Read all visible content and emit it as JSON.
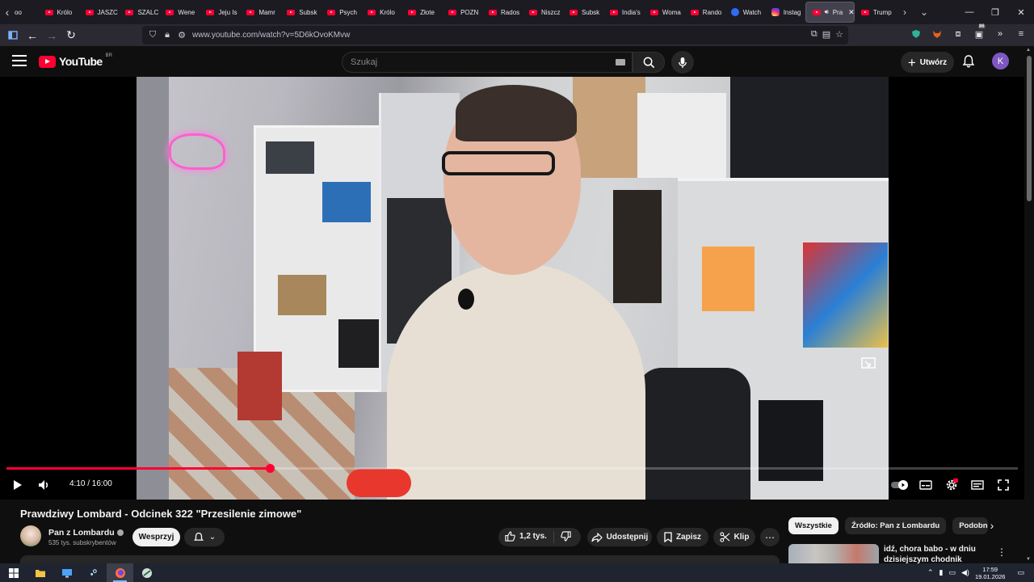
{
  "browser": {
    "tabs": [
      {
        "title": "Królo",
        "icon": "youtube-icon"
      },
      {
        "title": "JASZC",
        "icon": "youtube-icon"
      },
      {
        "title": "SZALC",
        "icon": "youtube-icon"
      },
      {
        "title": "Wene",
        "icon": "youtube-icon"
      },
      {
        "title": "Jeju Is",
        "icon": "youtube-icon"
      },
      {
        "title": "Mamr",
        "icon": "youtube-icon"
      },
      {
        "title": "Subsk",
        "icon": "youtube-icon"
      },
      {
        "title": "Psych",
        "icon": "youtube-icon"
      },
      {
        "title": "Królo",
        "icon": "youtube-icon"
      },
      {
        "title": "Złote",
        "icon": "youtube-icon"
      },
      {
        "title": "POZN",
        "icon": "youtube-icon"
      },
      {
        "title": "Rados",
        "icon": "youtube-icon"
      },
      {
        "title": "Niszcz",
        "icon": "youtube-icon"
      },
      {
        "title": "Subsk",
        "icon": "youtube-icon"
      },
      {
        "title": "India's",
        "icon": "youtube-icon"
      },
      {
        "title": "Woma",
        "icon": "youtube-icon"
      },
      {
        "title": "Rando",
        "icon": "youtube-icon"
      },
      {
        "title": "Watch",
        "icon": "watch-icon"
      },
      {
        "title": "Instag",
        "icon": "instagram-icon"
      }
    ],
    "active_tab": {
      "title": "Pra"
    },
    "trailing_tab": {
      "title": "Trump"
    },
    "first_tab_partial": "oo",
    "url": "www.youtube.com/watch?v=5D6kOvoKMvw",
    "extension_badge": "86"
  },
  "youtube": {
    "logo_text": "YouTube",
    "country_code": "BR",
    "search_placeholder": "Szukaj",
    "create_label": "Utwórz",
    "avatar_letter": "K"
  },
  "player": {
    "current_time": "4:10",
    "duration": "16:00",
    "time_display": "4:10 / 16:00",
    "progress_fraction": 0.26
  },
  "video": {
    "title": "Prawdziwy Lombard - Odcinek 322 \"Przesilenie zimowe\"",
    "channel_name": "Pan z Lombardu",
    "subscribers": "535 tys. subskrybentów",
    "support_label": "Wesprzyj",
    "likes": "1,2 tys.",
    "share_label": "Udostępnij",
    "save_label": "Zapisz",
    "clip_label": "Klip"
  },
  "sidebar": {
    "chips": [
      "Wszystkie",
      "Źródło: Pan z Lombardu",
      "Podobne"
    ],
    "active_chip": "Wszystkie",
    "recommendation_title": "idź, chora babo - w dniu dzisiejszym chodnik pieszym"
  },
  "taskbar": {
    "time": "17:59",
    "date": "19.01.2026"
  },
  "colors": {
    "accent": "#ff0033",
    "background": "#0f0f0f",
    "avatar": "#7e57c2"
  }
}
